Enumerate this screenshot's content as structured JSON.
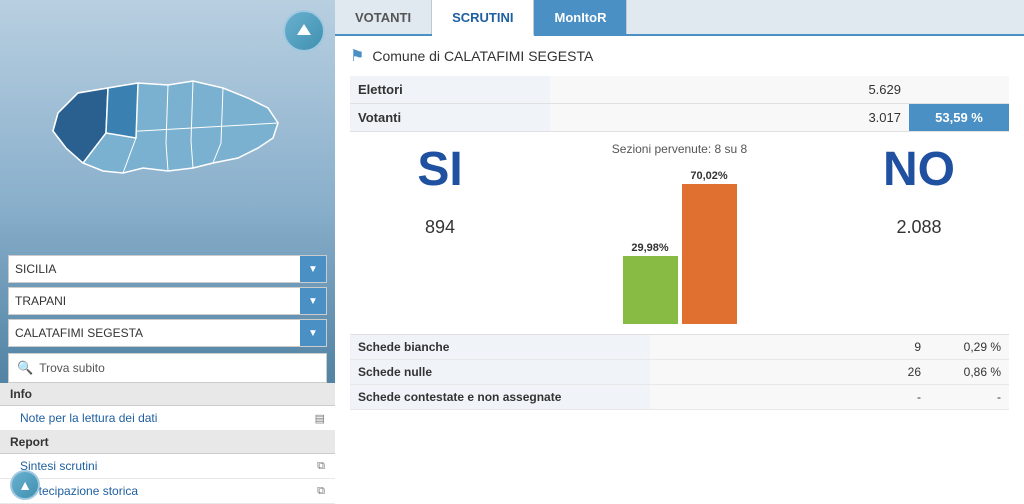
{
  "tabs": [
    {
      "id": "votanti",
      "label": "VOTANTI",
      "active": false
    },
    {
      "id": "scrutini",
      "label": "SCRUTINI",
      "active": true
    },
    {
      "id": "monitor",
      "label": "MonItoR",
      "active": false,
      "special": true
    }
  ],
  "location": {
    "prefix": "Comune di",
    "name": "CALATAFIMI SEGESTA"
  },
  "elettori": {
    "label": "Elettori",
    "value": "5.629"
  },
  "votanti": {
    "label": "Votanti",
    "value": "3.017",
    "percent": "53,59 %"
  },
  "sezioni": {
    "label": "Sezioni pervenute: 8 su 8"
  },
  "si": {
    "label": "SI",
    "count": "894",
    "percent": "29,98%"
  },
  "no": {
    "label": "NO",
    "count": "2.088",
    "percent": "70,02%"
  },
  "schede": [
    {
      "label": "Schede bianche",
      "value": "9",
      "percent": "0,29 %"
    },
    {
      "label": "Schede nulle",
      "value": "26",
      "percent": "0,86 %"
    },
    {
      "label": "Schede contestate e non assegnate",
      "value": "-",
      "percent": "-"
    }
  ],
  "dropdowns": [
    {
      "label": "SICILIA"
    },
    {
      "label": "TRAPANI"
    },
    {
      "label": "CALATAFIMI SEGESTA"
    }
  ],
  "search": {
    "label": "Trova subito"
  },
  "sidebar": {
    "info_header": "Info",
    "items_info": [
      {
        "label": "Note per la lettura dei dati",
        "icon": "doc"
      }
    ],
    "report_header": "Report",
    "items_report": [
      {
        "label": "Sintesi scrutini",
        "icon": "page"
      },
      {
        "label": "Partecipazione storica",
        "icon": "page"
      }
    ]
  }
}
